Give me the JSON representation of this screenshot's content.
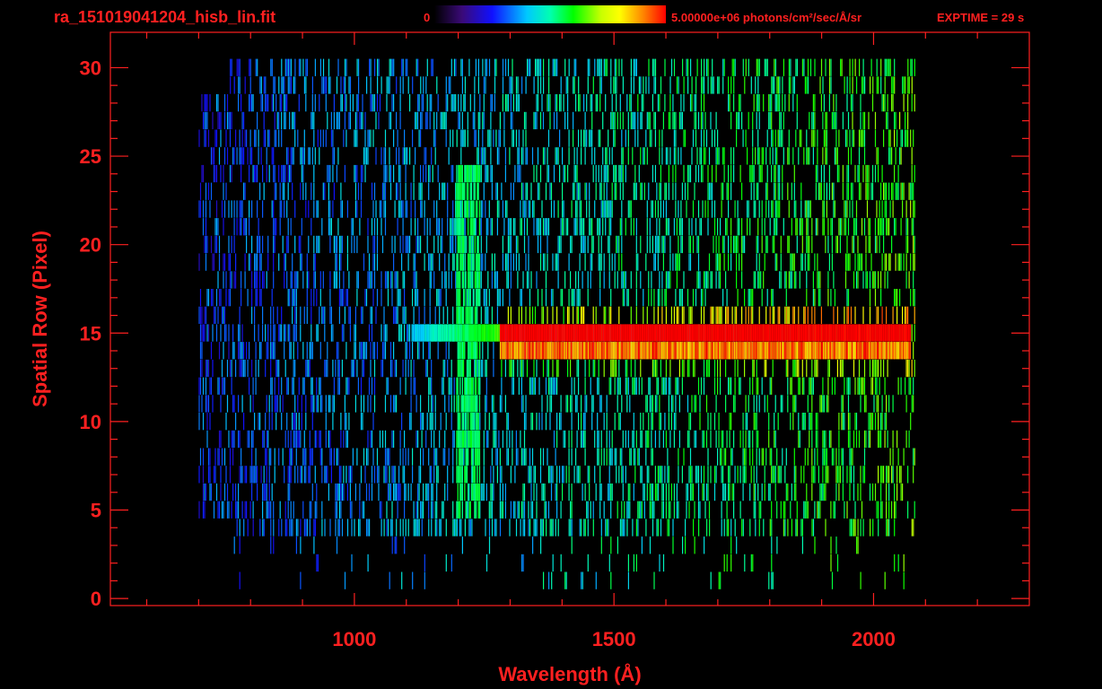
{
  "header": {
    "filename": "ra_151019041204_hisb_lin.fit",
    "colorbar_min_label": "0",
    "colorbar_max_label": "5.00000e+06 photons/cm²/sec/Å/sr",
    "exptime_label": "EXPTIME = 29 s"
  },
  "colors": {
    "background": "#000000",
    "axes_text": "#ff2020"
  },
  "chart_data": {
    "type": "heatmap",
    "xlabel": "Wavelength (Å)",
    "ylabel": "Spatial Row (Pixel)",
    "xlim": [
      530,
      2300
    ],
    "ylim": [
      -0.4,
      32
    ],
    "xticks": [
      1000,
      1500,
      2000
    ],
    "yticks": [
      0,
      5,
      10,
      15,
      20,
      25,
      30
    ],
    "colorbar": {
      "min": 0,
      "max": 5000000.0,
      "unit": "photons/cm²/sec/Å/sr",
      "colormap": "rainbow"
    },
    "features": [
      {
        "name": "continuum",
        "rows": [
          14,
          15
        ],
        "x_range": [
          1280,
          2070
        ],
        "level": 1.0
      },
      {
        "name": "faint-extension",
        "rows": [
          15
        ],
        "x_range": [
          1110,
          1280
        ],
        "level": 0.55
      },
      {
        "name": "emission-line",
        "x": 1216,
        "rows_range": [
          5,
          24
        ],
        "level": 0.55
      },
      {
        "name": "noise-field",
        "rows_range": [
          1,
          30
        ],
        "x_range": [
          700,
          2080
        ],
        "level": 0.35
      }
    ]
  }
}
